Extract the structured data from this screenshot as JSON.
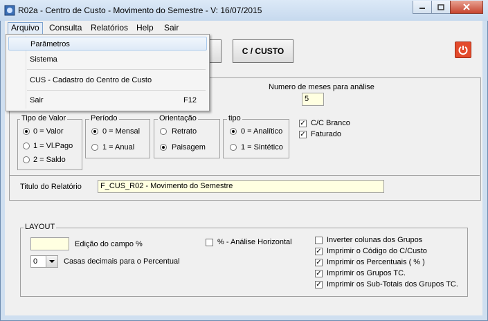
{
  "window": {
    "title": "R02a - Centro de Custo - Movimento do Semestre - V: 16/07/2015"
  },
  "menubar": {
    "items": [
      "Arquivo",
      "Consulta",
      "Relatórios",
      "Help",
      "Sair"
    ]
  },
  "arquivo_menu": {
    "items": [
      {
        "label": "Parâmetros",
        "shortcut": ""
      },
      {
        "label": "Sistema",
        "shortcut": ""
      },
      {
        "label": "CUS - Cadastro do Centro de Custo",
        "shortcut": ""
      },
      {
        "label": "Sair",
        "shortcut": "F12"
      }
    ]
  },
  "toolbar": {
    "ccusto_label": "C / CUSTO"
  },
  "analysis": {
    "months_label": "Numero de meses para análise",
    "months_value": "5"
  },
  "tipo_valor": {
    "legend": "Tipo de Valor",
    "options": [
      "0 = Valor",
      "1 = Vl.Pago",
      "2 = Saldo"
    ],
    "selected": 0
  },
  "periodo": {
    "legend": "Período",
    "options": [
      "0 = Mensal",
      "1 = Anual"
    ],
    "selected": 0
  },
  "orientacao": {
    "legend": "Orientação",
    "options": [
      "Retrato",
      "Paisagem"
    ],
    "selected": 1
  },
  "tipo": {
    "legend": "tipo",
    "options": [
      "0 = Analítico",
      "1 = Sintético"
    ],
    "selected": 0
  },
  "flags": [
    {
      "label": "C/C Branco",
      "checked": true
    },
    {
      "label": "Faturado",
      "checked": true
    }
  ],
  "report_title": {
    "label": "Titulo do Relatório",
    "value": "F_CUS_R02 - Movimento do Semestre"
  },
  "layout": {
    "legend": "LAYOUT",
    "edicao_label": "Edição do campo %",
    "casas_value": "0",
    "casas_label": "Casas decimais para o Percentual",
    "horizontal_label": "% - Análise Horizontal",
    "options": [
      {
        "label": "Inverter colunas dos Grupos",
        "checked": false
      },
      {
        "label": "Imprimir o Código do C/Custo",
        "checked": true
      },
      {
        "label": "Imprimir os Percentuais ( % )",
        "checked": true
      },
      {
        "label": "Imprimir os Grupos TC.",
        "checked": true
      },
      {
        "label": "Imprimir os Sub-Totais dos Grupos TC.",
        "checked": true
      }
    ]
  },
  "colors": {
    "accent": "#3399ff",
    "title_bar": "#c6d9ee",
    "input_yellow": "#ffffe1",
    "power_red": "#e34b2c"
  }
}
